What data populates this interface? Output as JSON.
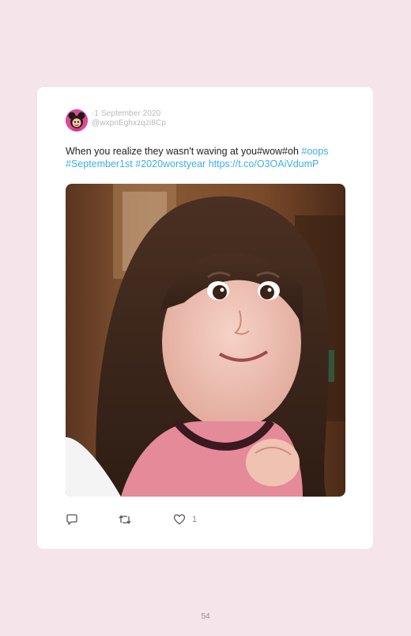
{
  "tweet": {
    "date": "·1 September 2020",
    "handle": "@wxpnEghxzqzi8Cp",
    "text_plain": "When you realize they wasn't waving at you#wow#oh ",
    "text_links": [
      "#oops",
      "#September1st",
      "#2020worstyear",
      "https://t.co/O3OAiVdumP"
    ],
    "like_count": "1",
    "avatar_icon": "cartoon-avatar-icon",
    "photo": "girl-photo"
  },
  "actions": {
    "reply_icon": "reply-icon",
    "retweet_icon": "retweet-icon",
    "like_icon": "heart-icon"
  },
  "page": {
    "number": "54"
  },
  "colors": {
    "background": "#f5e4e9",
    "card": "#ffffff",
    "link": "#3eaee6",
    "avatar": "#e0479a"
  }
}
